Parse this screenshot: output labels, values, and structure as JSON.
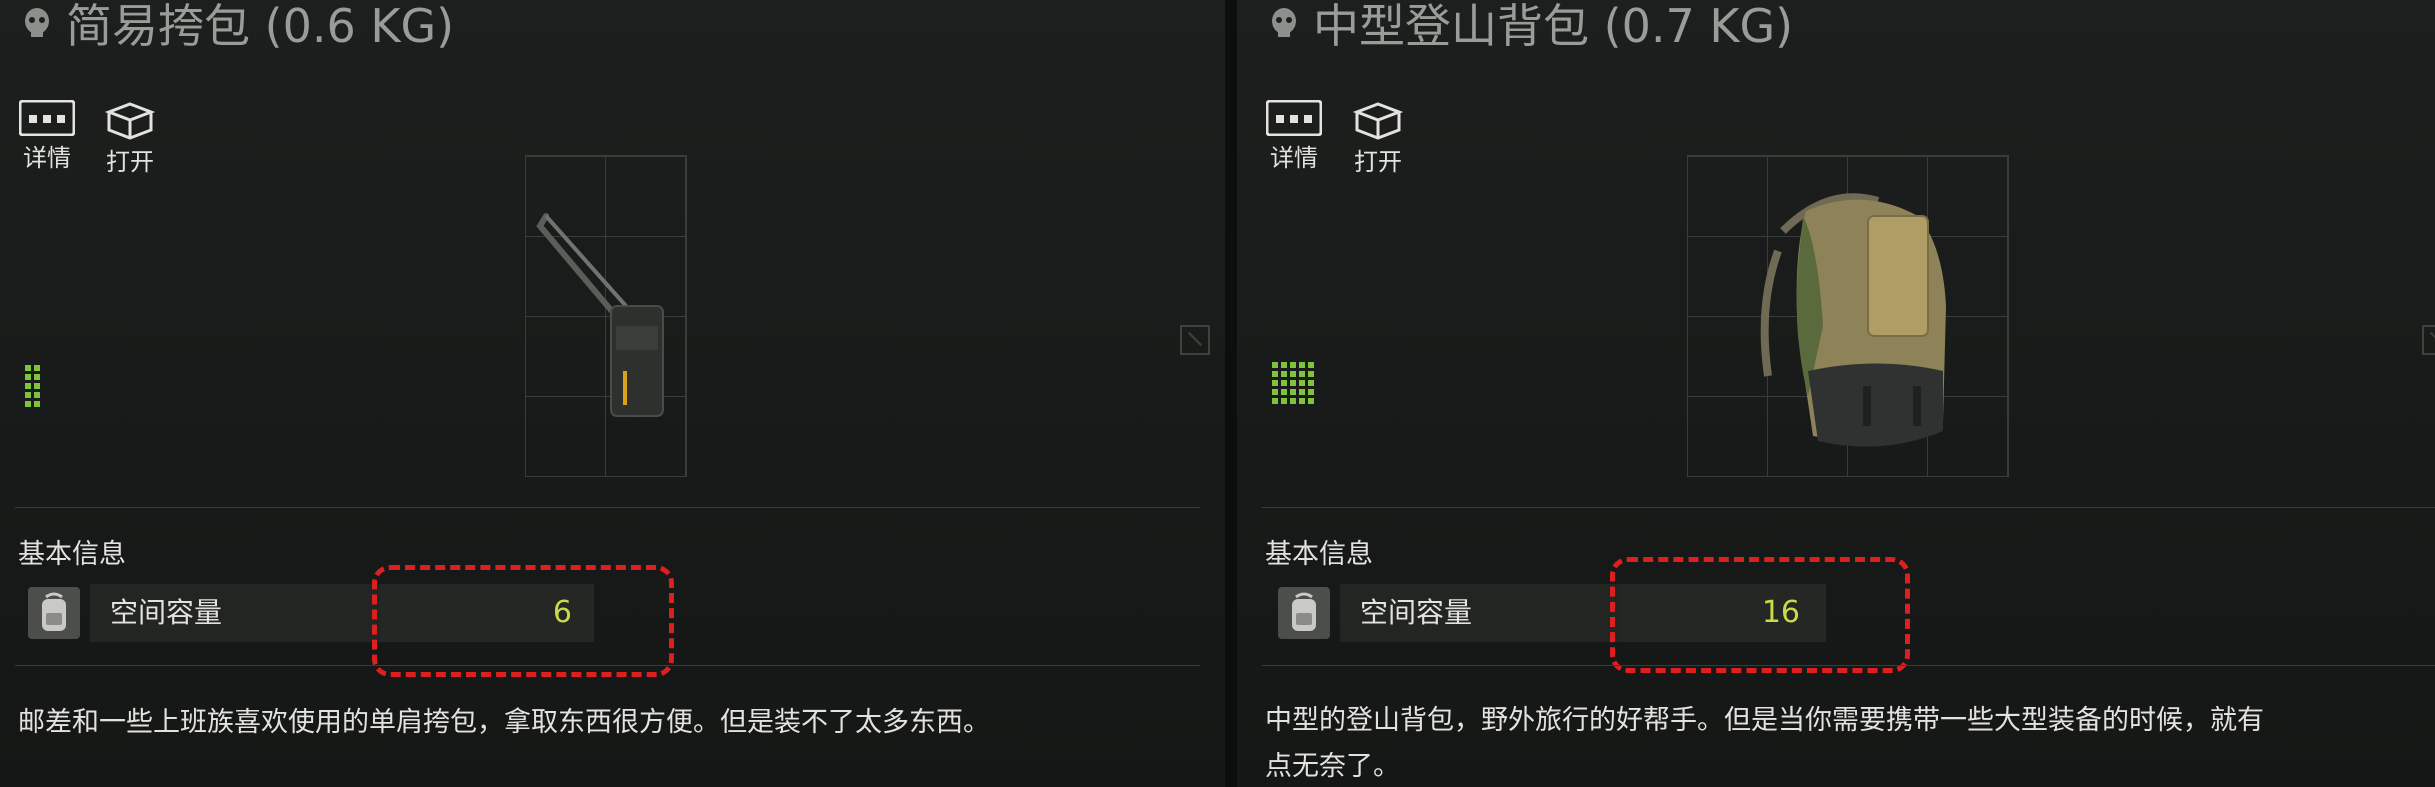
{
  "panels": [
    {
      "title": "简易挎包 (0.6 KG)",
      "actions": [
        {
          "label": "详情",
          "icon": "more-dots-icon"
        },
        {
          "label": "打开",
          "icon": "open-box-icon"
        }
      ],
      "section_label": "基本信息",
      "stat": {
        "label": "空间容量",
        "value": "6",
        "icon": "backpack-icon"
      },
      "description": "邮差和一些上班族喜欢使用的单肩挎包，拿取东西很方便。但是装不了太多东西。",
      "item_image": "shoulder-bag-image",
      "size_indicator": "grid-size-icon"
    },
    {
      "title": "中型登山背包 (0.7 KG)",
      "actions": [
        {
          "label": "详情",
          "icon": "more-dots-icon"
        },
        {
          "label": "打开",
          "icon": "open-box-icon"
        }
      ],
      "section_label": "基本信息",
      "stat": {
        "label": "空间容量",
        "value": "16",
        "icon": "backpack-icon"
      },
      "description_line1": "中型的登山背包，野外旅行的好帮手。但是当你需要携带一些大型装备的时候，就有",
      "description_line2": "点无奈了。",
      "item_image": "hiking-backpack-image",
      "size_indicator": "grid-size-icon"
    }
  ],
  "colors": {
    "highlight_box": "#dd1f1f",
    "stat_value": "#c9d94a",
    "size_indicator": "#7fc23c"
  }
}
